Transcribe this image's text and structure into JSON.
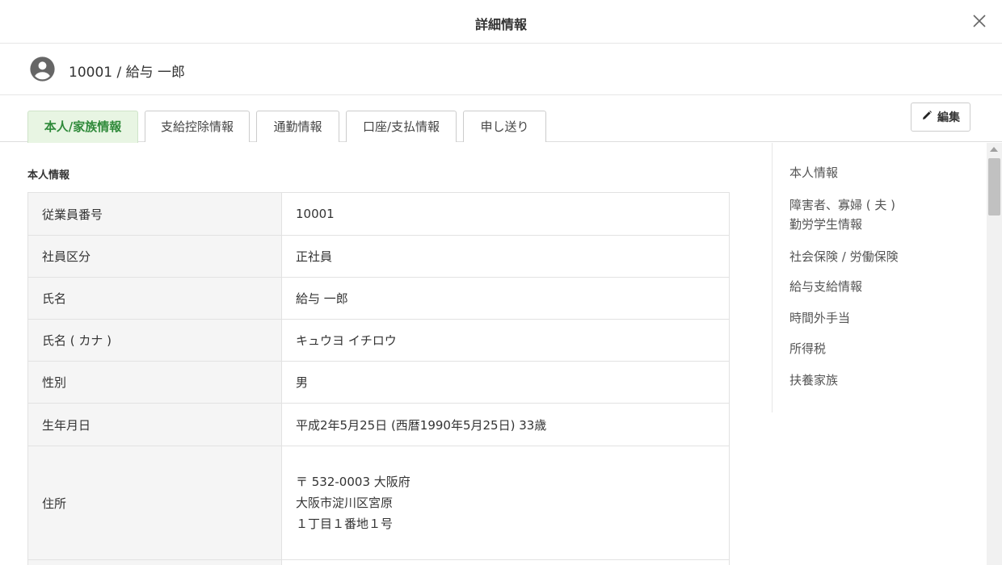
{
  "header": {
    "title": "詳細情報",
    "close_icon": "close-icon"
  },
  "person": {
    "avatar_icon": "account-circle-icon",
    "label": "10001 / 給与 一郎"
  },
  "tabs": [
    {
      "label": "本人/家族情報",
      "active": true
    },
    {
      "label": "支給控除情報",
      "active": false
    },
    {
      "label": "通勤情報",
      "active": false
    },
    {
      "label": "口座/支払情報",
      "active": false
    },
    {
      "label": "申し送り",
      "active": false
    }
  ],
  "edit_button": {
    "label": "編集",
    "icon": "pencil-icon"
  },
  "section": {
    "title": "本人情報"
  },
  "rows": [
    {
      "label": "従業員番号",
      "value": "10001"
    },
    {
      "label": "社員区分",
      "value": "正社員"
    },
    {
      "label": "氏名",
      "value": "給与 一郎"
    },
    {
      "label": "氏名 ( カナ )",
      "value": "キュウヨ イチロウ"
    },
    {
      "label": "性別",
      "value": "男"
    },
    {
      "label": "生年月日",
      "value": "平成2年5月25日 (西暦1990年5月25日) 33歳"
    },
    {
      "label": "住所",
      "lines": [
        "〒 532-0003 大阪府",
        "大阪市淀川区宮原",
        "１丁目１番地１号"
      ]
    }
  ],
  "side_nav": {
    "items": [
      "本人情報",
      "障害者、寡婦 ( 夫 )",
      "勤労学生情報",
      "社会保険 / 労働保険",
      "給与支給情報",
      "時間外手当",
      "所得税",
      "扶養家族"
    ]
  },
  "colors": {
    "accent_green": "#2f8a3a",
    "active_tab_bg": "#e8f5e3",
    "label_cell_bg": "#f5f5f5"
  }
}
